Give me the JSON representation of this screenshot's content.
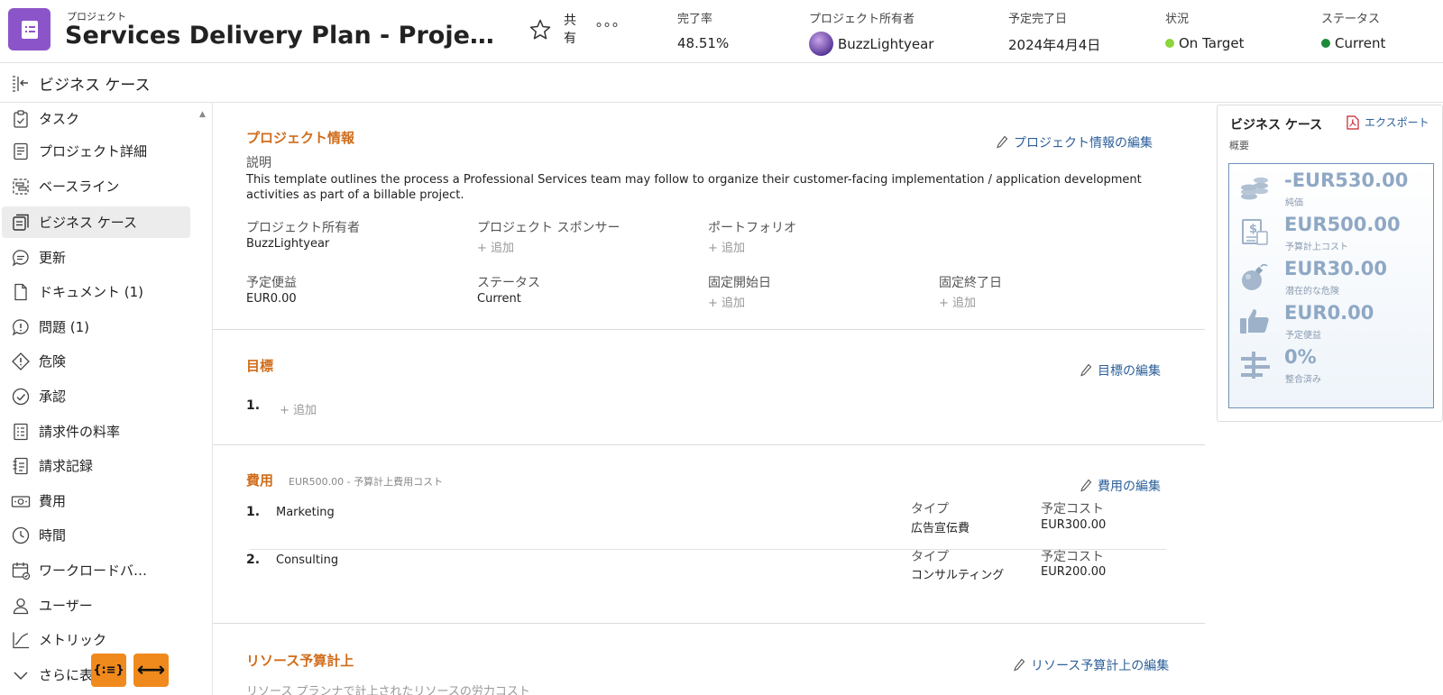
{
  "header": {
    "kicker": "プロジェクト",
    "title": "Services Delivery Plan - Project Sa…",
    "share_label": "共有",
    "more_label": "°°°",
    "stats": {
      "completion": {
        "label": "完了率",
        "value": "48.51%"
      },
      "owner": {
        "label": "プロジェクト所有者",
        "value": "BuzzLightyear"
      },
      "planned_end": {
        "label": "予定完了日",
        "value": "2024年4月4日"
      },
      "condition": {
        "label": "状況",
        "value": "On Target",
        "color": "#8bd43c"
      },
      "status": {
        "label": "ステータス",
        "value": "Current",
        "color": "#1e8a3a"
      }
    }
  },
  "subheader": {
    "title": "ビジネス ケース"
  },
  "sidebar": {
    "items": [
      {
        "label": "タスク",
        "icon": "task-clipboard-icon"
      },
      {
        "label": "プロジェクト詳細",
        "icon": "document-lines-icon"
      },
      {
        "label": "ベースライン",
        "icon": "baseline-icon"
      },
      {
        "label": "ビジネス ケース",
        "icon": "business-case-icon",
        "active": true
      },
      {
        "label": "更新",
        "icon": "chat-bubble-icon"
      },
      {
        "label": "ドキュメント (1)",
        "icon": "document-icon"
      },
      {
        "label": "問題 (1)",
        "icon": "issue-bubble-icon"
      },
      {
        "label": "危険",
        "icon": "risk-diamond-icon"
      },
      {
        "label": "承認",
        "icon": "approval-check-icon"
      },
      {
        "label": "請求件の料率",
        "icon": "billing-rates-icon"
      },
      {
        "label": "請求記録",
        "icon": "billing-records-icon"
      },
      {
        "label": "費用",
        "icon": "expenses-icon"
      },
      {
        "label": "時間",
        "icon": "clock-icon"
      },
      {
        "label": "ワークロードバ…",
        "icon": "workload-calendar-icon"
      },
      {
        "label": "ユーザー",
        "icon": "users-icon"
      },
      {
        "label": "メトリック",
        "icon": "metrics-chart-icon"
      },
      {
        "label": "さらに表示",
        "icon": "chevron-down-icon"
      }
    ]
  },
  "project_info": {
    "title": "プロジェクト情報",
    "edit_label": "プロジェクト情報の編集",
    "description_label": "説明",
    "description": "This template outlines the process a Professional Services team may follow to organize their customer-facing implementation / application development activities as part of a billable project.",
    "owner_label": "プロジェクト所有者",
    "owner_value": "BuzzLightyear",
    "sponsor_label": "プロジェクト スポンサー",
    "sponsor_value": "+ 追加",
    "portfolio_label": "ポートフォリオ",
    "portfolio_value": "+ 追加",
    "benefit_label": "予定便益",
    "benefit_value": "EUR0.00",
    "status_label": "ステータス",
    "status_value": "Current",
    "fixed_start_label": "固定開始日",
    "fixed_start_value": "+ 追加",
    "fixed_end_label": "固定終了日",
    "fixed_end_value": "+ 追加"
  },
  "objectives": {
    "title": "目標",
    "edit_label": "目標の編集",
    "item_num": "1.",
    "add_label": "+ 追加"
  },
  "expenses": {
    "title": "費用",
    "summary": "EUR500.00 - 予算計上費用コスト",
    "edit_label": "費用の編集",
    "type_label": "タイプ",
    "cost_label": "予定コスト",
    "items": [
      {
        "num": "1.",
        "name": "Marketing",
        "type": "広告宣伝費",
        "cost": "EUR300.00"
      },
      {
        "num": "2.",
        "name": "Consulting",
        "type": "コンサルティング",
        "cost": "EUR200.00"
      }
    ]
  },
  "resource_budget": {
    "title": "リソース予算計上",
    "edit_label": "リソース予算計上の編集",
    "subtitle": "リソース プランナで計上されたリソースの労力コスト"
  },
  "right_panel": {
    "title": "ビジネス ケース",
    "subtitle": "概要",
    "export_label": "エクスポート",
    "rows": [
      {
        "amount": "-EUR530.00",
        "caption": "純価",
        "icon": "coins-stack-icon"
      },
      {
        "amount": "EUR500.00",
        "caption": "予算計上コスト",
        "icon": "invoice-dollar-icon"
      },
      {
        "amount": "EUR30.00",
        "caption": "潜在的な危険",
        "icon": "bomb-icon"
      },
      {
        "amount": "EUR0.00",
        "caption": "予定便益",
        "icon": "thumbs-up-icon"
      },
      {
        "amount": "0%",
        "caption": "整合済み",
        "icon": "alignment-icon"
      }
    ]
  },
  "fabs": {
    "left_symbol": "{:≡}",
    "right_symbol": "⟷"
  }
}
